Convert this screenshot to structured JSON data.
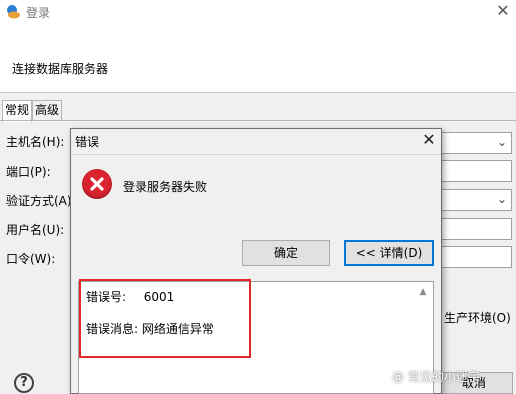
{
  "window": {
    "title": "登录",
    "header_text": "连接数据库服务器"
  },
  "tabs": [
    {
      "label": "常规",
      "active": true
    },
    {
      "label": "高级",
      "active": false
    }
  ],
  "fields": {
    "host_label": "主机名(H):",
    "port_label": "端口(P):",
    "auth_label": "验证方式(A)",
    "user_label": "用户名(U):",
    "password_label": "口令(W):"
  },
  "production_label": "生产环境(O)",
  "cancel_label": "取消",
  "help_icon_text": "?",
  "dialog": {
    "title": "错误",
    "message": "登录服务器失败",
    "ok_label": "确定",
    "details_label": "<< 详情(D)",
    "error_code_label": "错误号:",
    "error_code_value": "6001",
    "error_message_label": "错误消息:",
    "error_message_value": "网络通信异常"
  },
  "watermark": "@ 常见的小迷宇",
  "colors": {
    "error_red": "#d9242f",
    "highlight_red": "#e0282a",
    "default_button_border": "#0078d7"
  }
}
